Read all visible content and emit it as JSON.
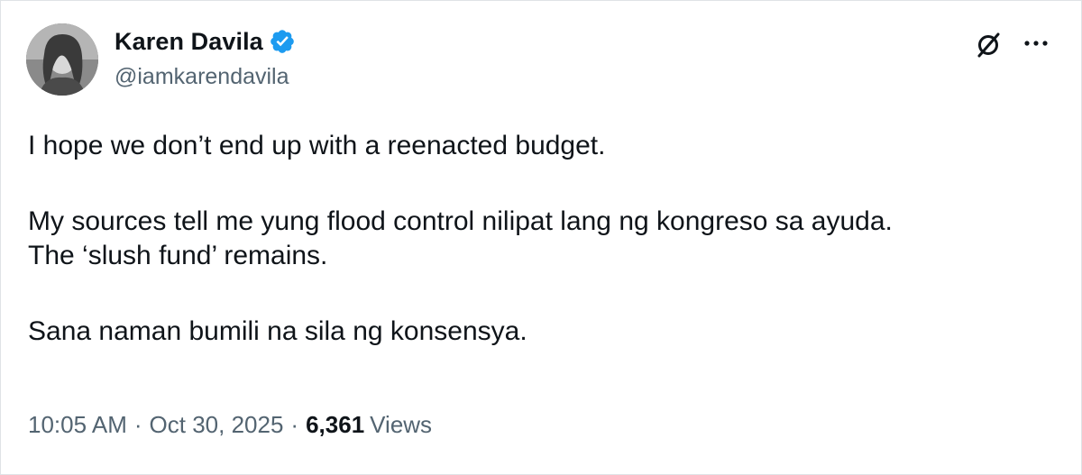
{
  "author": {
    "display_name": "Karen Davila",
    "handle": "@iamkarendavila",
    "verified": true
  },
  "icons": {
    "verified": "verified-badge-icon",
    "grok": "grok-icon",
    "more": "more-icon"
  },
  "tweet": {
    "line1": "I hope we don’t end up with a reenacted budget.",
    "line2": "My sources tell me yung flood control nilipat lang ng kongreso sa ayuda.",
    "line3": "The ‘slush fund’ remains.",
    "line4": "Sana naman bumili na sila ng konsensya."
  },
  "meta": {
    "time": "10:05 AM",
    "separator": "·",
    "date": "Oct 30, 2025",
    "views_count": "6,361",
    "views_label": "Views"
  },
  "colors": {
    "verified_blue": "#1d9bf0",
    "secondary_text": "#536471",
    "primary_text": "#0f1419"
  }
}
